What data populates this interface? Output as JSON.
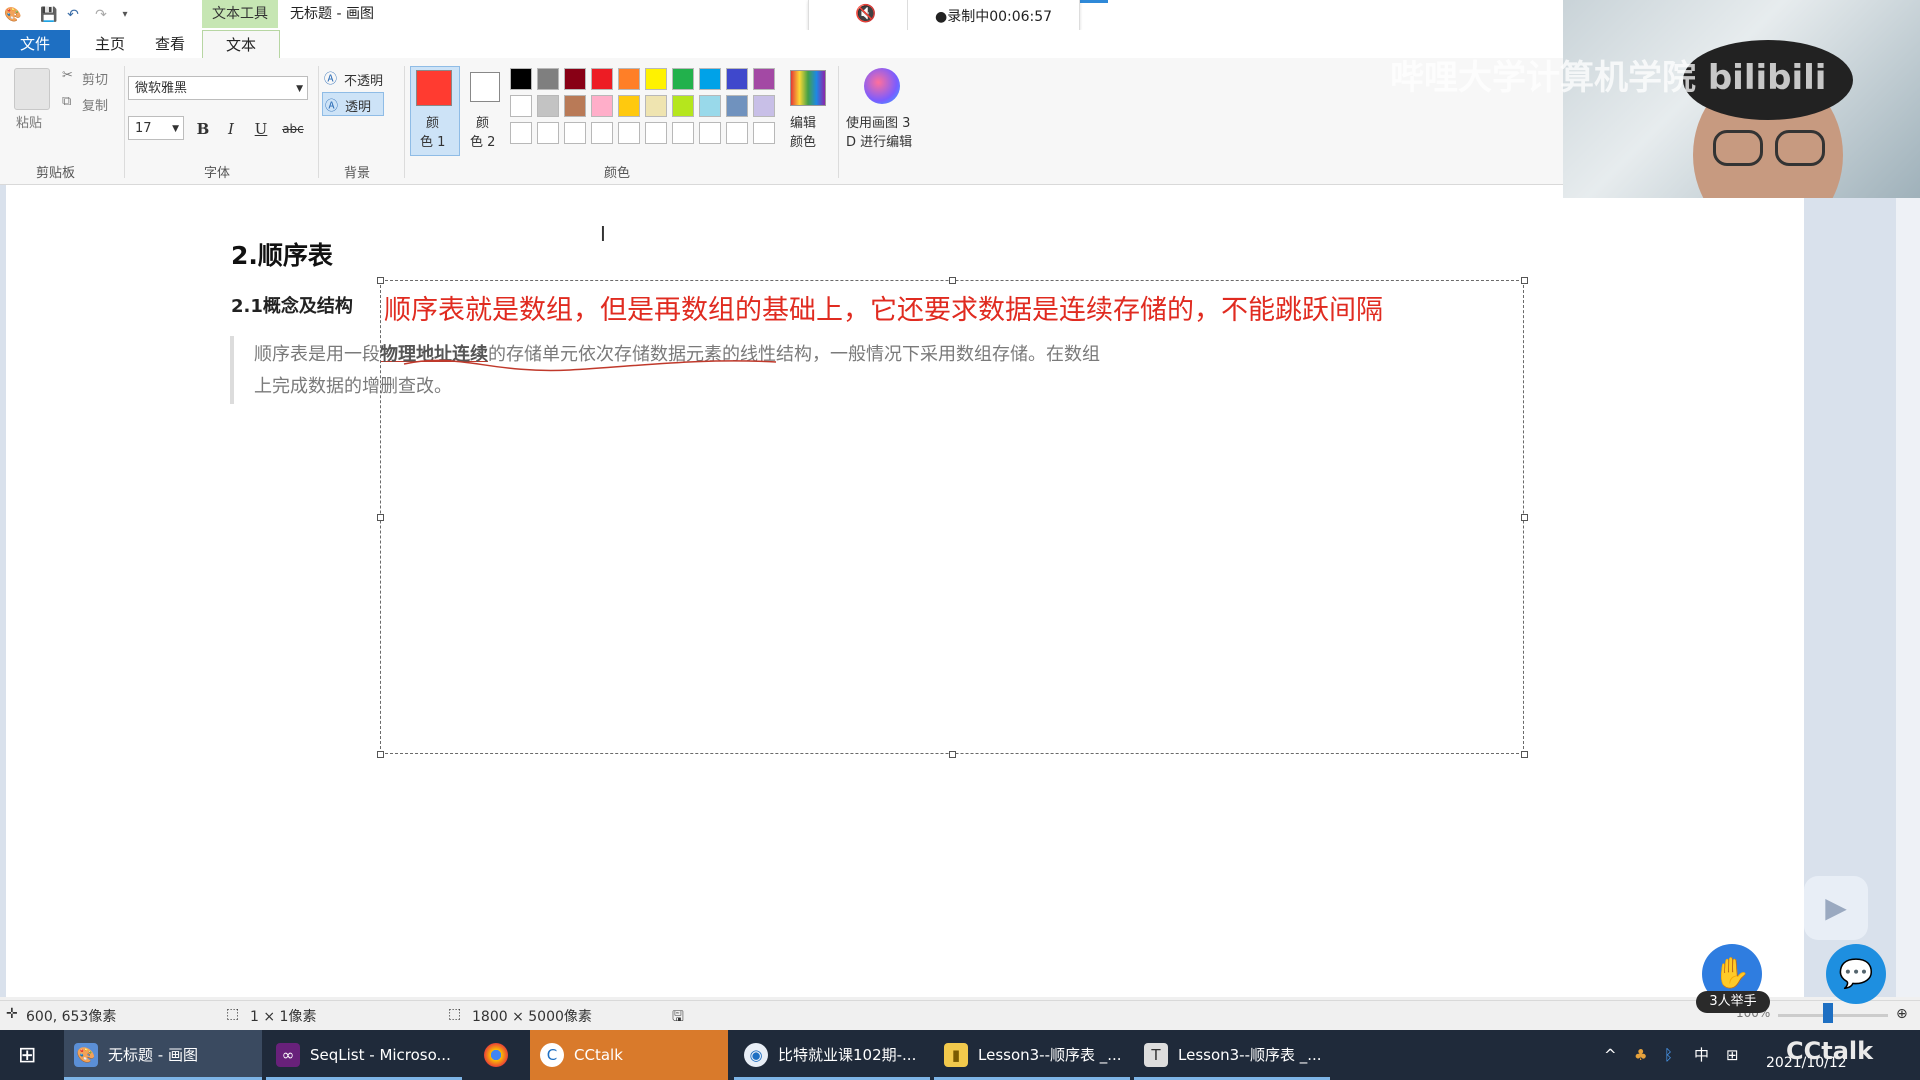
{
  "colors": {
    "accent_blue": "#1e6fc2",
    "red_text": "#e02b20",
    "contextual_green": "#c6e6b3",
    "taskbar": "#1f2a3a"
  },
  "window": {
    "contextual_tab": "文本工具",
    "title": "无标题 - 画图"
  },
  "recording": {
    "text": "●录制中00:06:57",
    "mute_icon": "speaker-muted-icon"
  },
  "tabs": {
    "file": "文件",
    "home": "主页",
    "view": "查看",
    "text": "文本"
  },
  "ribbon": {
    "clipboard": {
      "paste": "粘贴",
      "cut": "剪切",
      "copy": "复制",
      "group_label": "剪贴板"
    },
    "font": {
      "family": "微软雅黑",
      "size": "17",
      "bold": "B",
      "italic": "I",
      "underline": "U",
      "strike": "abc",
      "group_label": "字体"
    },
    "background": {
      "opaque": "不透明",
      "transparent": "透明",
      "group_label": "背景"
    },
    "colors": {
      "color1": "颜\n色 1",
      "color1_l1": "颜",
      "color1_l2": "色 1",
      "color2_l1": "颜",
      "color2_l2": "色 2",
      "edit_l1": "编辑",
      "edit_l2": "颜色",
      "paint3d_l1": "使用画图 3",
      "paint3d_l2": "D 进行编辑",
      "group_label": "颜色",
      "color1_value": "#ff3b30",
      "color2_value": "#ffffff",
      "palette_row1": [
        "#000000",
        "#7f7f7f",
        "#880015",
        "#ed1c24",
        "#ff7f27",
        "#fff200",
        "#22b14c",
        "#00a2e8",
        "#3f48cc",
        "#a349a4"
      ],
      "palette_row2": [
        "#ffffff",
        "#c3c3c3",
        "#b97a57",
        "#ffaec9",
        "#ffc90e",
        "#efe4b0",
        "#b5e61d",
        "#99d9ea",
        "#7092be",
        "#c8bfe7"
      ],
      "palette_row3": [
        "#ffffff",
        "#ffffff",
        "#ffffff",
        "#ffffff",
        "#ffffff",
        "#ffffff",
        "#ffffff",
        "#ffffff",
        "#ffffff",
        "#ffffff"
      ]
    }
  },
  "document": {
    "heading": "2.顺序表",
    "subheading": "2.1概念及结构",
    "typed_text": "顺序表就是数组，但是再数组的基础上，它还要求数据是连续存储的，不能跳跃间隔",
    "para_prefix": "顺序表是用一段",
    "para_bold": "物理地址连续",
    "para_rest": "的存储单元依次存储数据元素的线性结构，一般情况下采用数组存储。在数组",
    "para_line2": "上完成数据的增删查改。"
  },
  "status": {
    "cursor_pos": "600, 653像素",
    "selection_size": "1 × 1像素",
    "canvas_size": "1800 × 5000像素",
    "zoom": "100%"
  },
  "webcam": {
    "watermark": "哔哩大学计算机学院 bilibili"
  },
  "floating": {
    "raise_hand_label": "3人举手"
  },
  "taskbar": {
    "items": [
      {
        "label": "无标题 - 画图"
      },
      {
        "label": "SeqList - Microso..."
      },
      {
        "label": ""
      },
      {
        "label": "CCtalk"
      },
      {
        "label": "比特就业课102期-..."
      },
      {
        "label": "Lesson3--顺序表 _..."
      },
      {
        "label": "Lesson3--顺序表 _..."
      }
    ],
    "ime": "中",
    "date": "2021/10/12",
    "brand": "CCtalk"
  }
}
